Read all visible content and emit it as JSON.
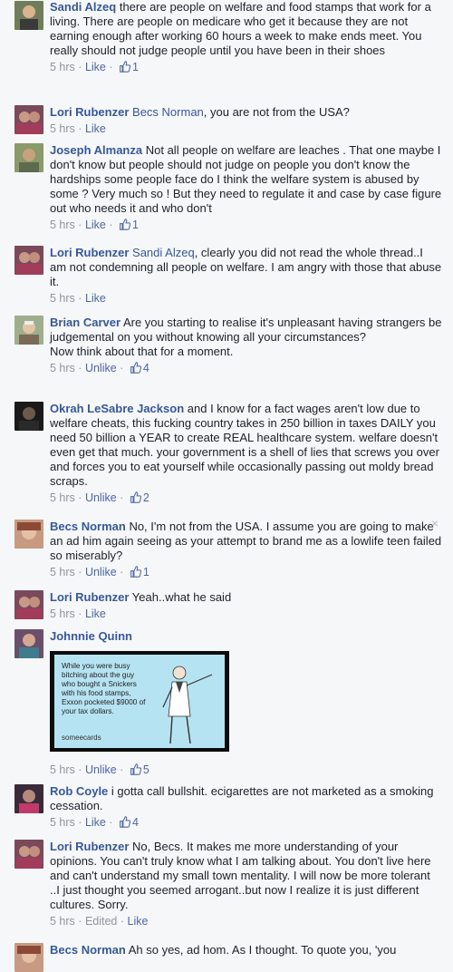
{
  "comments": [
    {
      "author": "Sandi Alzeq",
      "mention": "",
      "text": "there are people on welfare and food stamps that work for a living. There are people on medicare who get it because they are not earning enough after working 60 hours a week to make ends meet. You really should not judge people until you have been in their shoes",
      "time": "5 hrs",
      "action": "Like",
      "likes": "1"
    },
    {
      "author": "Lori Rubenzer",
      "mention": "Becs Norman",
      "text": ", you are not from the USA?",
      "time": "5 hrs",
      "action": "Like",
      "likes": ""
    },
    {
      "author": "Joseph Almanza",
      "mention": "",
      "text": "Not all people on welfare are leaches . That one maybe I don't know but people should not judge on people you don't know the hardships some people face do I think the welfare system is abused by some ? Very much so ! But they need to regulate it and case by case figure out who needs it and who don't",
      "time": "5 hrs",
      "action": "Like",
      "likes": "1"
    },
    {
      "author": "Lori Rubenzer",
      "mention": "Sandi Alzeq",
      "text": ", clearly you did not read the whole thread..I am not condemning all people on welfare. I am angry with those that abuse it.",
      "time": "5 hrs",
      "action": "Like",
      "likes": ""
    },
    {
      "author": "Brian Carver",
      "mention": "",
      "text": "Are you starting to realise it's unpleasant having strangers be judgemental on you without knowing all your circumstances?",
      "text2": "Now think about that for a moment.",
      "time": "5 hrs",
      "action": "Unlike",
      "likes": "4"
    },
    {
      "author": "Okrah LeSabre Jackson",
      "mention": "",
      "text": "and I know for a fact wages aren't low due to welfare cheats, this fucking country takes in 250 billion in taxes DAILY you need 50 billion a YEAR to create REAL healthcare system. welfare doesn't even get that much. your government is a shell of lies that screws you over and forces you to eat yourself while occasionally passing out moldy bread scraps.",
      "time": "5 hrs",
      "action": "Unlike",
      "likes": "2"
    },
    {
      "author": "Becs Norman",
      "mention": "",
      "text": "No, I'm not from the USA. I assume you are going to make an ad him again seeing as your attempt to brand me as a lowlife teen failed so miserably?",
      "time": "5 hrs",
      "action": "Unlike",
      "likes": "1"
    },
    {
      "author": "Lori Rubenzer",
      "mention": "",
      "text": "Yeah..what he said",
      "time": "5 hrs",
      "action": "Like",
      "likes": ""
    },
    {
      "author": "Johnnie Quinn",
      "mention": "",
      "text": "",
      "ecard_text": "While you were busy bitching about the guy who bought a Snickers with his food stamps, Exxon pocketed $9000 of your tax dollars.",
      "ecard_brand": "someecards",
      "time": "5 hrs",
      "action": "Unlike",
      "likes": "5"
    },
    {
      "author": "Rob Coyle",
      "mention": "",
      "text": "i gotta call bullshit. ecigarettes are not marketed as a smoking cessation.",
      "time": "5 hrs",
      "action": "Like",
      "likes": "4"
    },
    {
      "author": "Lori Rubenzer",
      "mention": "",
      "text": "No, Becs. It makes me more understanding of your opinions. You can't truly know what I am talking about. You don't live here and can't understand my small town mentality. I will now be more tolerant ..I just thought you seemed arrogant..but now I realize it is just different cultures. Sorry.",
      "time": "5 hrs",
      "edited": "Edited",
      "action": "Like",
      "likes": ""
    },
    {
      "author": "Becs Norman",
      "mention": "",
      "text": "Ah so yes, ad hom. As I thought. To quote you, 'you",
      "time": "",
      "action": "",
      "likes": ""
    }
  ],
  "dot": "·",
  "close_glyph": "×",
  "icons": {
    "like": "thumbs-up-icon",
    "close": "close-icon"
  },
  "colors": {
    "link": "#365899",
    "meta": "#90949c",
    "background": "#f6f7f9"
  }
}
